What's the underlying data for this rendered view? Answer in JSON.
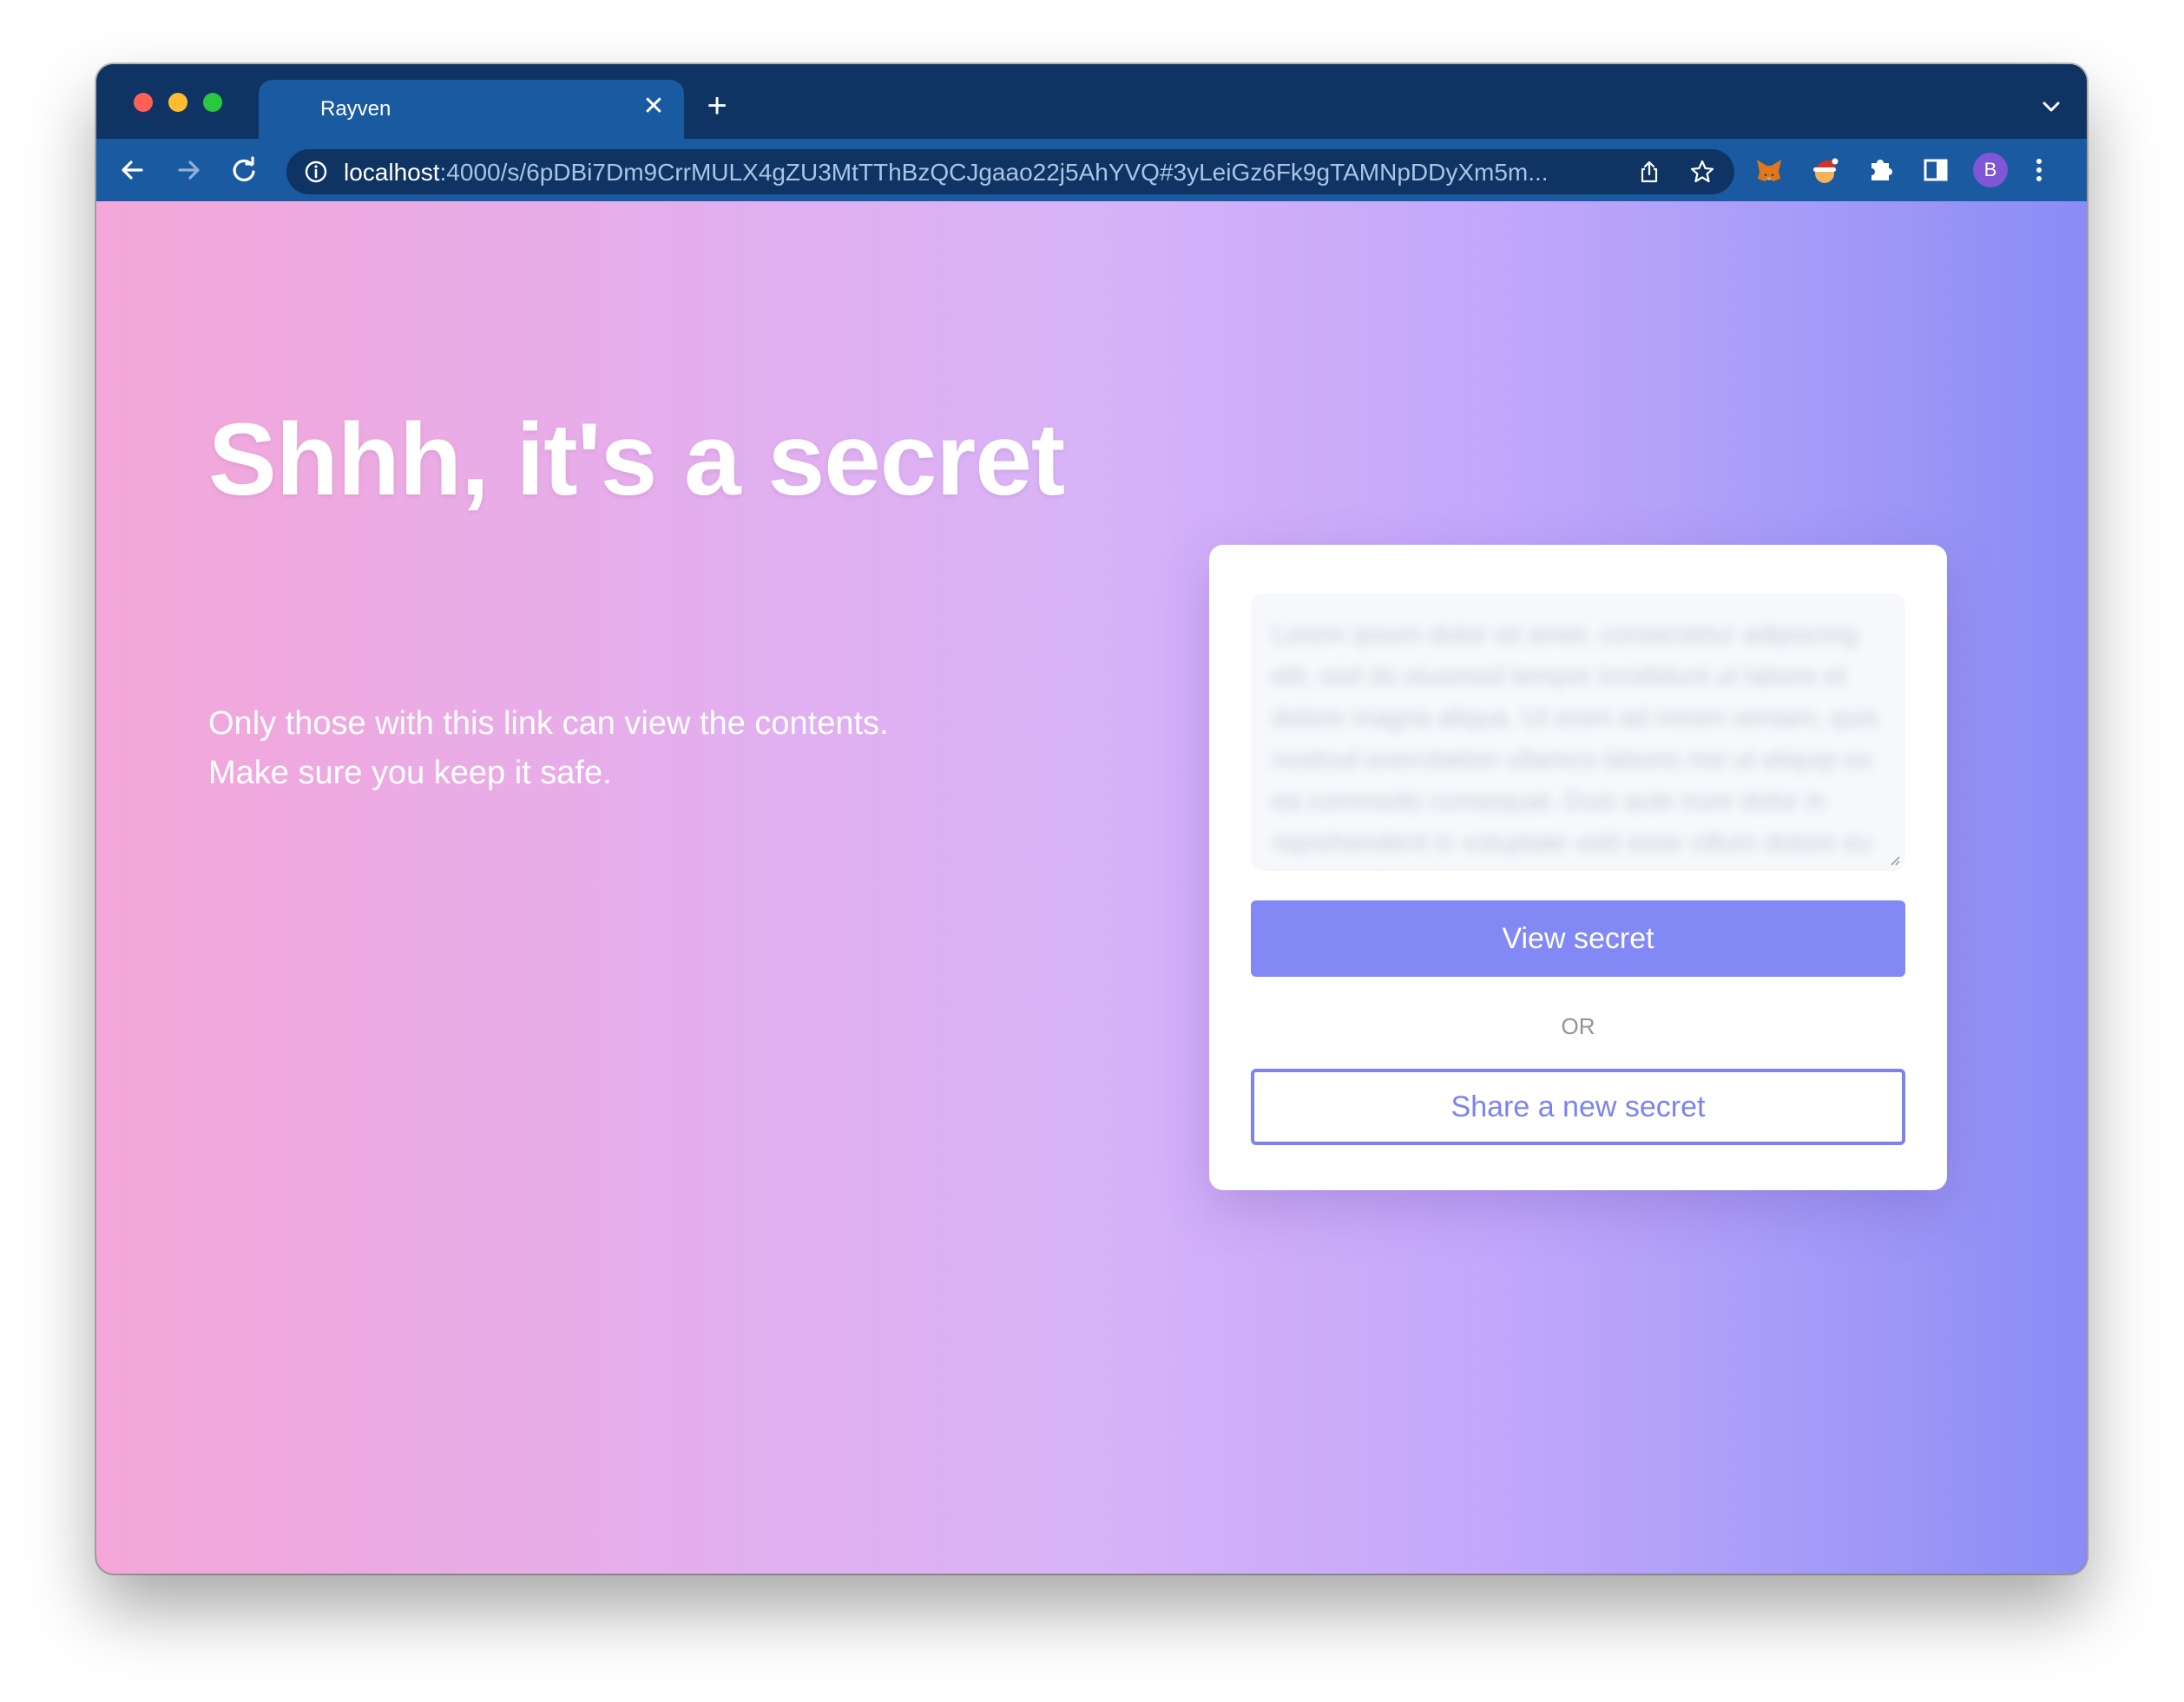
{
  "browser": {
    "tab_title": "Rayven",
    "tab_close": "✕",
    "new_tab": "+",
    "url_host": "localhost",
    "url_rest": ":4000/s/6pDBi7Dm9CrrMULX4gZU3MtTThBzQCJgaao22j5AhYVQ#3yLeiGz6Fk9gTAMNpDDyXm5m...",
    "profile_initial": "B",
    "icons": {
      "back": "back-arrow-icon",
      "forward": "forward-arrow-icon",
      "reload": "reload-icon",
      "info": "info-icon",
      "share": "share-icon",
      "bookmark": "star-icon",
      "extensions": [
        "metamask-icon",
        "santa-hat-icon",
        "puzzle-icon",
        "side-panel-icon"
      ],
      "menu": "kebab-menu-icon",
      "tab_list": "chevron-down-icon"
    }
  },
  "page": {
    "title": "Shhh, it's a secret",
    "subtitle_line1": "Only those with this link can view the contents.",
    "subtitle_line2": "Make sure you keep it safe."
  },
  "card": {
    "secret_text": "Lorem ipsum dolor sit amet, consectetur adipiscing elit, sed do eiusmod tempor incididunt ut labore et dolore magna aliqua. Ut enim ad minim veniam, quis nostrud exercitation ullamco laboris nisi ut aliquip ex ea commodo consequat. Duis aute irure dolor in reprehenderit in voluptate velit esse cillum dolore eu fugiat nulla pariatur.",
    "view_button": "View secret",
    "or_label": "OR",
    "share_button": "Share a new secret"
  },
  "colors": {
    "titlebar": "#0f3463",
    "toolbar": "#1a5aa0",
    "accent": "#8289f4",
    "gradient_start": "#f4a7d8",
    "gradient_end": "#8a8cf5"
  }
}
